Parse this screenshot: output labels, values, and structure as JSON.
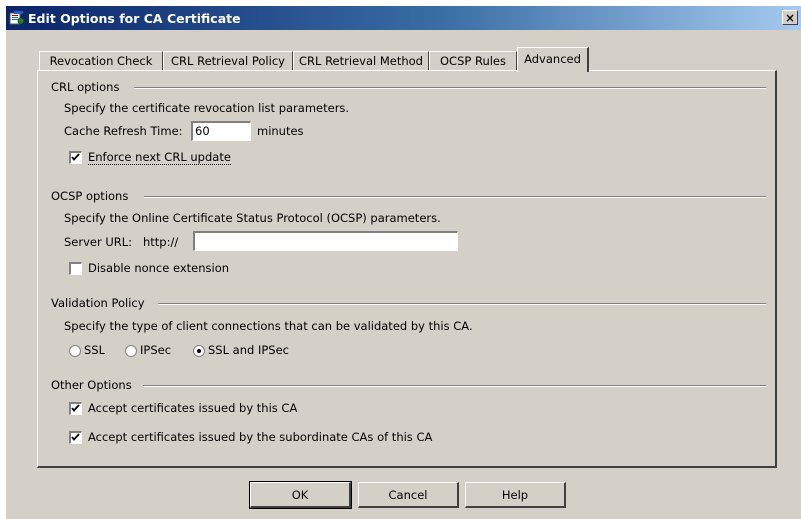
{
  "window": {
    "title": "Edit Options for CA Certificate",
    "close_label": "×"
  },
  "tabs": [
    {
      "label": "Revocation Check"
    },
    {
      "label": "CRL Retrieval Policy"
    },
    {
      "label": "CRL Retrieval Method"
    },
    {
      "label": "OCSP Rules"
    },
    {
      "label": "Advanced"
    }
  ],
  "crl_options": {
    "title": "CRL options",
    "description": "Specify the certificate revocation list parameters.",
    "cache_refresh_label": "Cache Refresh Time:",
    "cache_refresh_value": "60",
    "cache_refresh_unit": "minutes",
    "enforce_label": "Enforce next CRL update",
    "enforce_checked": true
  },
  "ocsp_options": {
    "title": "OCSP options",
    "description": "Specify the Online Certificate Status Protocol (OCSP)  parameters.",
    "server_url_label": "Server URL:",
    "server_url_prefix": "http://",
    "server_url_value": "",
    "nonce_label": "Disable nonce extension",
    "nonce_checked": false
  },
  "validation_policy": {
    "title": "Validation Policy",
    "description": "Specify the type of client connections that can be validated by this CA.",
    "options": [
      {
        "label": "SSL",
        "selected": false
      },
      {
        "label": "IPSec",
        "selected": false
      },
      {
        "label": "SSL and IPSec",
        "selected": true
      }
    ]
  },
  "other_options": {
    "title": "Other Options",
    "accept_ca_label": "Accept certificates issued by this CA",
    "accept_ca_checked": true,
    "accept_sub_label": "Accept certificates issued by the subordinate CAs of this CA",
    "accept_sub_checked": true
  },
  "buttons": {
    "ok": "OK",
    "cancel": "Cancel",
    "help": "Help"
  },
  "colors": {
    "title_bar_start": "#0a246a",
    "title_bar_end": "#a6caf0",
    "dialog_face": "#d4d0c8"
  }
}
